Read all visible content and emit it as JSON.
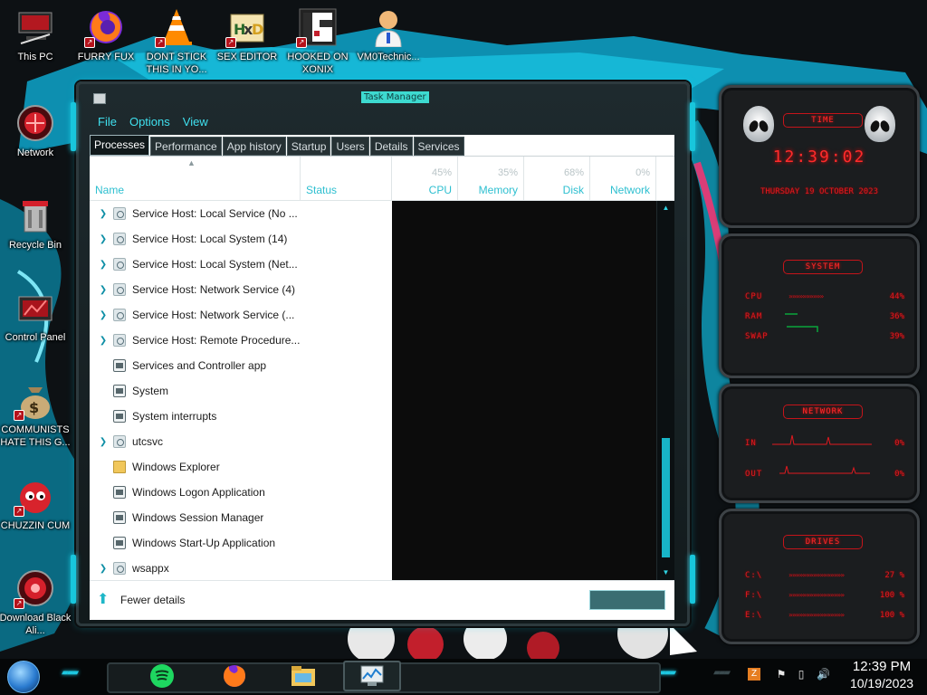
{
  "desktop": {
    "icons": [
      {
        "label": "This PC"
      },
      {
        "label": "FURRY FUX"
      },
      {
        "label": "DONT STICK THIS IN YO..."
      },
      {
        "label": "SEX EDITOR"
      },
      {
        "label": "HOOKED ON XONIX"
      },
      {
        "label": "VM0Technic..."
      },
      {
        "label": "Network"
      },
      {
        "label": "Recycle Bin"
      },
      {
        "label": "Control Panel"
      },
      {
        "label": "COMMUNISTS HATE THIS G..."
      },
      {
        "label": "CHUZZIN CUM"
      },
      {
        "label": "Download Black Ali..."
      }
    ]
  },
  "taskmanager": {
    "title": "Task Manager",
    "menu": [
      "File",
      "Options",
      "View"
    ],
    "tabs": [
      "Processes",
      "Performance",
      "App history",
      "Startup",
      "Users",
      "Details",
      "Services"
    ],
    "active_tab": "Processes",
    "columns": {
      "name": "Name",
      "status": "Status",
      "cpu": {
        "label": "CPU",
        "pct": "45%"
      },
      "memory": {
        "label": "Memory",
        "pct": "35%"
      },
      "disk": {
        "label": "Disk",
        "pct": "68%"
      },
      "network": {
        "label": "Network",
        "pct": "0%"
      }
    },
    "processes": [
      {
        "name": "Service Host: Local Service (No ...",
        "expandable": true,
        "icon": "gear-icon"
      },
      {
        "name": "Service Host: Local System (14)",
        "expandable": true,
        "icon": "gear-icon"
      },
      {
        "name": "Service Host: Local System (Net...",
        "expandable": true,
        "icon": "gear-icon"
      },
      {
        "name": "Service Host: Network Service (4)",
        "expandable": true,
        "icon": "gear-icon"
      },
      {
        "name": "Service Host: Network Service (...",
        "expandable": true,
        "icon": "gear-icon"
      },
      {
        "name": "Service Host: Remote Procedure...",
        "expandable": true,
        "icon": "gear-icon"
      },
      {
        "name": "Services and Controller app",
        "expandable": false,
        "icon": "window-icon"
      },
      {
        "name": "System",
        "expandable": false,
        "icon": "window-icon"
      },
      {
        "name": "System interrupts",
        "expandable": false,
        "icon": "window-icon"
      },
      {
        "name": "utcsvc",
        "expandable": true,
        "icon": "gear-icon"
      },
      {
        "name": "Windows Explorer",
        "expandable": false,
        "icon": "folder-icon"
      },
      {
        "name": "Windows Logon Application",
        "expandable": false,
        "icon": "window-icon"
      },
      {
        "name": "Windows Session Manager",
        "expandable": false,
        "icon": "window-icon"
      },
      {
        "name": "Windows Start-Up Application",
        "expandable": false,
        "icon": "window-icon"
      },
      {
        "name": "wsappx",
        "expandable": true,
        "icon": "gear-icon"
      }
    ],
    "footer": {
      "fewer_details": "Fewer details",
      "end_task": ""
    }
  },
  "gadgets": {
    "time": {
      "header": "TIME",
      "clock": "12:39:02",
      "date": "THURSDAY 19 OCTOBER 2023"
    },
    "system": {
      "header": "SYSTEM",
      "cpu_label": "CPU",
      "cpu_value": "44%",
      "ram_label": "RAM",
      "ram_value": "36%",
      "swap_label": "SWAP",
      "swap_value": "39%"
    },
    "network": {
      "header": "NETWORK",
      "in_label": "IN",
      "in_value": "0%",
      "out_label": "OUT",
      "out_value": "0%"
    },
    "drives": {
      "header": "DRIVES",
      "drives": [
        {
          "label": "C:\\",
          "value": "27 %"
        },
        {
          "label": "F:\\",
          "value": "100 %"
        },
        {
          "label": "E:\\",
          "value": "100 %"
        }
      ]
    }
  },
  "taskbar": {
    "clock_time": "12:39 PM",
    "clock_date": "10/19/2023"
  },
  "colors": {
    "accent": "#18c6dc",
    "gadget_red": "#e0191f"
  }
}
